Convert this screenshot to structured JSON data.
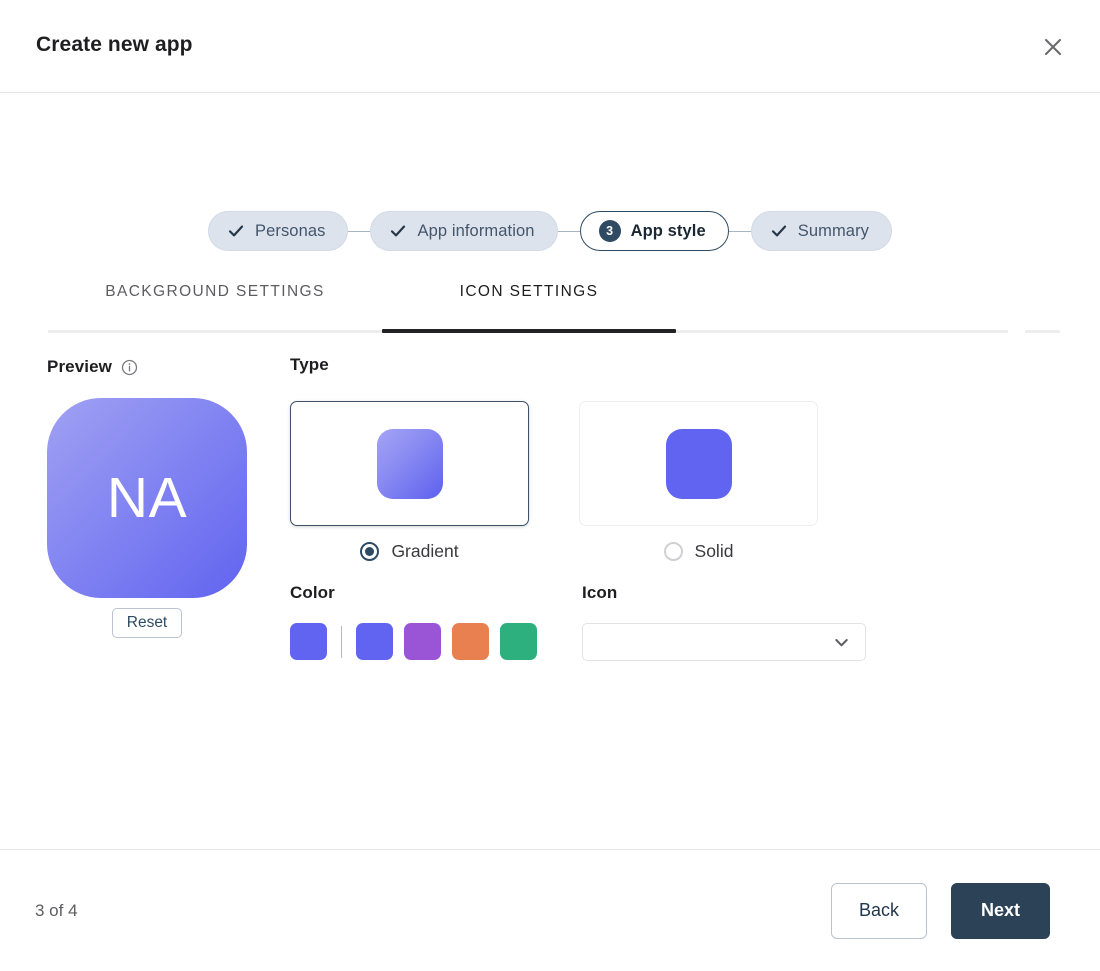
{
  "dialog": {
    "title": "Create new app",
    "close_icon": "close-icon"
  },
  "stepper": {
    "steps": [
      {
        "label": "Personas",
        "state": "complete",
        "icon": "check-icon"
      },
      {
        "label": "App information",
        "state": "complete",
        "icon": "check-icon"
      },
      {
        "label": "App style",
        "state": "active",
        "number": "3"
      },
      {
        "label": "Summary",
        "state": "complete",
        "icon": "check-icon"
      }
    ]
  },
  "tabs": [
    {
      "label": "BACKGROUND SETTINGS",
      "active": false
    },
    {
      "label": "ICON SETTINGS",
      "active": true
    }
  ],
  "preview": {
    "label": "Preview",
    "info_icon": "info-circle-icon",
    "initials": "NA",
    "gradient_from": "#a0a1f3",
    "gradient_to": "#6164f0",
    "reset_label": "Reset"
  },
  "type": {
    "label": "Type",
    "options": [
      {
        "label": "Gradient",
        "selected": true,
        "swatch": "gradient"
      },
      {
        "label": "Solid",
        "selected": false,
        "swatch": "solid"
      }
    ]
  },
  "color": {
    "label": "Color",
    "current": "#6164f0",
    "presets": [
      "#6164f0",
      "#9a55d6",
      "#e8814f",
      "#2eb07e"
    ]
  },
  "icon": {
    "label": "Icon",
    "value": "",
    "placeholder": "",
    "chevron_icon": "chevron-down-icon"
  },
  "footer": {
    "page_count": "3 of 4",
    "back_label": "Back",
    "next_label": "Next"
  }
}
